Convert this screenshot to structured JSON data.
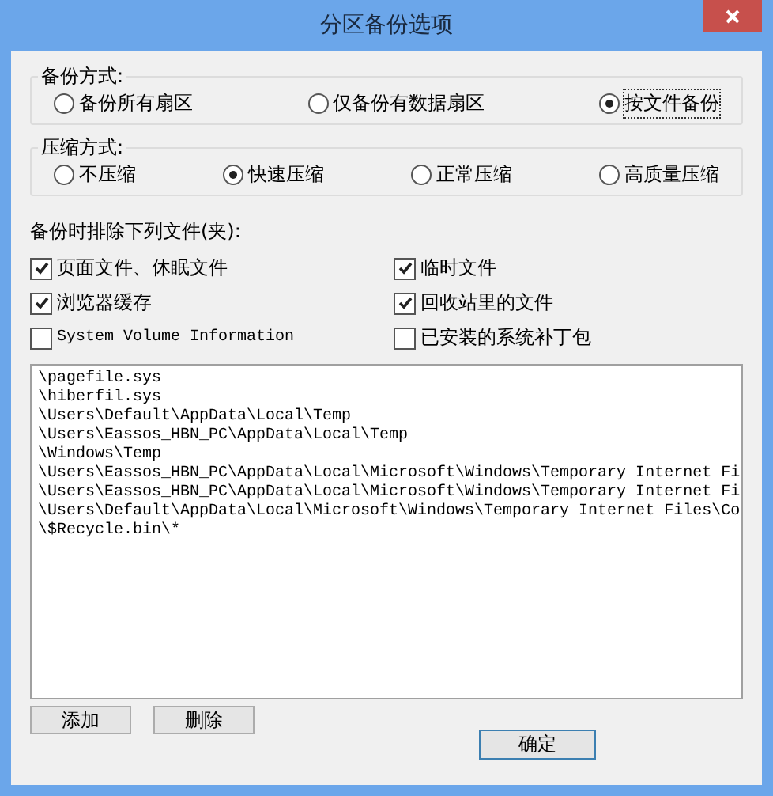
{
  "window": {
    "title": "分区备份选项"
  },
  "backup_mode": {
    "label": "备份方式:",
    "options": [
      {
        "label": "备份所有扇区",
        "selected": false
      },
      {
        "label": "仅备份有数据扇区",
        "selected": false
      },
      {
        "label": "按文件备份",
        "selected": true
      }
    ]
  },
  "compression": {
    "label": "压缩方式:",
    "options": [
      {
        "label": "不压缩",
        "selected": false
      },
      {
        "label": "快速压缩",
        "selected": true
      },
      {
        "label": "正常压缩",
        "selected": false
      },
      {
        "label": "高质量压缩",
        "selected": false
      }
    ]
  },
  "exclude_label": "备份时排除下列文件(夹):",
  "exclude_options": [
    {
      "label": "页面文件、休眠文件",
      "checked": true,
      "kind": "cjk"
    },
    {
      "label": "临时文件",
      "checked": true,
      "kind": "cjk"
    },
    {
      "label": "浏览器缓存",
      "checked": true,
      "kind": "cjk"
    },
    {
      "label": "回收站里的文件",
      "checked": true,
      "kind": "cjk"
    },
    {
      "label": "System Volume Information",
      "checked": false,
      "kind": "mono"
    },
    {
      "label": "已安装的系统补丁包",
      "checked": false,
      "kind": "cjk"
    }
  ],
  "exclude_list": [
    "\\pagefile.sys",
    "\\hiberfil.sys",
    "\\Users\\Default\\AppData\\Local\\Temp",
    "\\Users\\Eassos_HBN_PC\\AppData\\Local\\Temp",
    "\\Windows\\Temp",
    "\\Users\\Eassos_HBN_PC\\AppData\\Local\\Microsoft\\Windows\\Temporary Internet Fi",
    "\\Users\\Eassos_HBN_PC\\AppData\\Local\\Microsoft\\Windows\\Temporary Internet Fi",
    "\\Users\\Default\\AppData\\Local\\Microsoft\\Windows\\Temporary Internet Files\\Co",
    "\\$Recycle.bin\\*"
  ],
  "list_buttons": [
    "添加",
    "删除"
  ],
  "ok_button": "确定"
}
